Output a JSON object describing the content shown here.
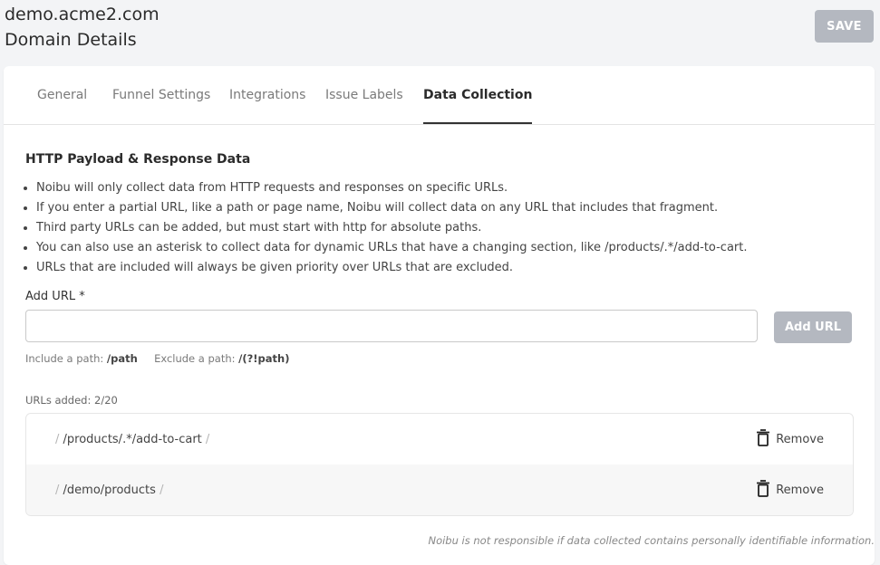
{
  "header": {
    "domain": "demo.acme2.com",
    "page_title": "Domain Details",
    "save_label": "SAVE"
  },
  "tabs": [
    {
      "label": "General",
      "active": false
    },
    {
      "label": "Funnel Settings",
      "active": false
    },
    {
      "label": "Integrations",
      "active": false
    },
    {
      "label": "Issue Labels",
      "active": false
    },
    {
      "label": "Data Collection",
      "active": true
    }
  ],
  "section": {
    "title": "HTTP Payload & Response Data",
    "bullets": [
      "Noibu will only collect data from HTTP requests and responses on specific URLs.",
      "If you enter a partial URL, like a path or page name, Noibu will collect data on any URL that includes that fragment.",
      "Third party URLs can be added, but must start with http for absolute paths.",
      "You can also use an asterisk to collect data for dynamic URLs that have a changing section, like /products/.*/add-to-cart.",
      "URLs that are included will always be given priority over URLs that are excluded."
    ]
  },
  "add_url": {
    "label": "Add URL *",
    "value": "",
    "placeholder": "",
    "button_label": "Add URL",
    "hint_include_label": "Include a path:",
    "hint_include_value": "/path",
    "hint_exclude_label": "Exclude a path:",
    "hint_exclude_value": "/(?!path)"
  },
  "urls": {
    "count_label": "URLs added: 2/20",
    "slash": "/",
    "remove_label": "Remove",
    "items": [
      {
        "path": "/products/.*/add-to-cart"
      },
      {
        "path": "/demo/products"
      }
    ]
  },
  "disclaimer": "Noibu is not responsible if data collected contains personally identifiable information.",
  "colors": {
    "button_disabled": "#b4b8c0",
    "active_tab": "#2b2b2b",
    "background": "#f3f4f6"
  }
}
